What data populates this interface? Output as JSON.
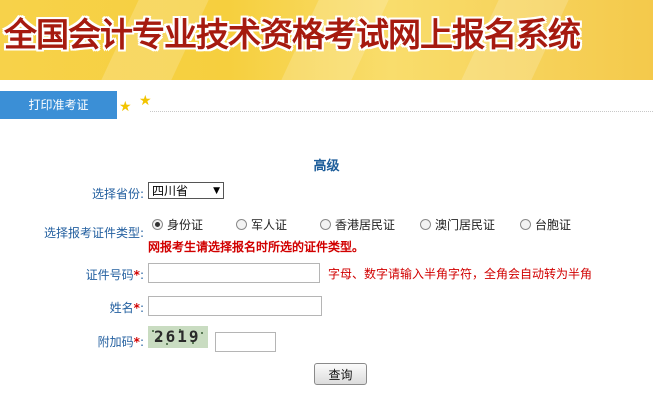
{
  "banner": {
    "title": "全国会计专业技术资格考试网上报名系统"
  },
  "tab": {
    "label": "打印准考证"
  },
  "form": {
    "section_title": "高级",
    "province_label": "选择省份",
    "province_value": "四川省",
    "id_type_label": "选择报考证件类型",
    "id_types": [
      {
        "label": "身份证",
        "selected": true
      },
      {
        "label": "军人证",
        "selected": false
      },
      {
        "label": "香港居民证",
        "selected": false
      },
      {
        "label": "澳门居民证",
        "selected": false
      },
      {
        "label": "台胞证",
        "selected": false
      }
    ],
    "id_type_warning": "网报考生请选择报名时所选的证件类型。",
    "id_number_label": "证件号码",
    "id_number_value": "",
    "id_number_hint": "字母、数字请输入半角字符，全角会自动转为半角",
    "name_label": "姓名",
    "name_value": "",
    "captcha_label": "附加码",
    "captcha_text": "2619",
    "captcha_value": "",
    "required_mark": "*",
    "colon": ":",
    "query_button": "查询"
  },
  "colors": {
    "accent": "#3b8fd6",
    "label": "#2460a0",
    "warning": "#d10000",
    "banner_text": "#a61a0f"
  }
}
